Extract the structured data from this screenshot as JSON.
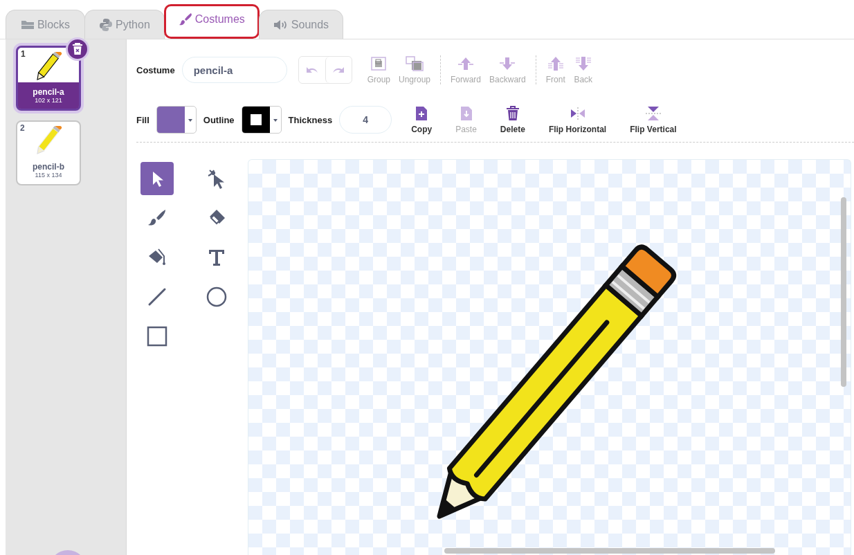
{
  "tabs": [
    {
      "label": "Blocks",
      "selected": false,
      "highlighted": false
    },
    {
      "label": "Python",
      "selected": false,
      "highlighted": false
    },
    {
      "label": "Costumes",
      "selected": true,
      "highlighted": true
    },
    {
      "label": "Sounds",
      "selected": false,
      "highlighted": false
    }
  ],
  "costumes": [
    {
      "number": "1",
      "name": "pencil-a",
      "size": "102 x 121",
      "selected": true
    },
    {
      "number": "2",
      "name": "pencil-b",
      "size": "115 x 134",
      "selected": false
    }
  ],
  "costume_field": {
    "label": "Costume",
    "value": "pencil-a"
  },
  "arrange_buttons": [
    {
      "kind": "group",
      "label": "Group",
      "disabled": true
    },
    {
      "kind": "ungroup",
      "label": "Ungroup",
      "disabled": true
    },
    {
      "kind": "forward",
      "label": "Forward",
      "disabled": true
    },
    {
      "kind": "backward",
      "label": "Backward",
      "disabled": true
    },
    {
      "kind": "front",
      "label": "Front",
      "disabled": true
    },
    {
      "kind": "back",
      "label": "Back",
      "disabled": true
    }
  ],
  "fill": {
    "label": "Fill",
    "color": "#7e63b0"
  },
  "outline": {
    "label": "Outline"
  },
  "thickness": {
    "label": "Thickness",
    "value": "4"
  },
  "action_buttons": [
    {
      "kind": "copy",
      "label": "Copy",
      "disabled": false
    },
    {
      "kind": "paste",
      "label": "Paste",
      "disabled": true
    },
    {
      "kind": "delete",
      "label": "Delete",
      "disabled": false
    },
    {
      "kind": "flip-horizontal",
      "label": "Flip Horizontal",
      "disabled": false
    },
    {
      "kind": "flip-vertical",
      "label": "Flip Vertical",
      "disabled": false
    }
  ],
  "tools": [
    {
      "kind": "select",
      "selected": true
    },
    {
      "kind": "reshape",
      "selected": false
    },
    {
      "kind": "brush",
      "selected": false
    },
    {
      "kind": "eraser",
      "selected": false
    },
    {
      "kind": "fill",
      "selected": false
    },
    {
      "kind": "text",
      "selected": false
    },
    {
      "kind": "line",
      "selected": false
    },
    {
      "kind": "circle",
      "selected": false
    },
    {
      "kind": "rectangle",
      "selected": false
    }
  ]
}
